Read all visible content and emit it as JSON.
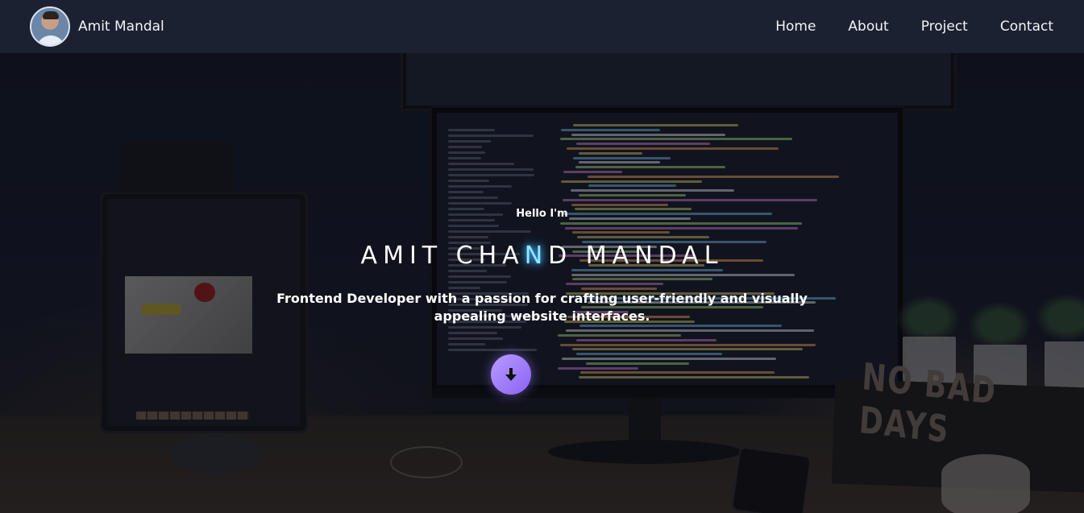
{
  "navbar": {
    "brand_name": "Amit Mandal",
    "links": [
      {
        "label": "Home"
      },
      {
        "label": "About"
      },
      {
        "label": "Project"
      },
      {
        "label": "Contact"
      }
    ]
  },
  "hero": {
    "greeting": "Hello I'm",
    "name_part_1": "AMIT CHA",
    "name_highlight": "N",
    "name_part_2": "D MANDAL",
    "tagline": "Frontend Developer with a passion for crafting user-friendly and visually appealing website interfaces.",
    "scroll_icon": "arrow-down-icon",
    "background_sign_text": "NO BAD DAYS"
  },
  "colors": {
    "navbar_bg": "#1b2130",
    "button_gradient_start": "#b69cff",
    "button_gradient_end": "#8a63f2",
    "highlight_glow": "#3fb7ff"
  }
}
